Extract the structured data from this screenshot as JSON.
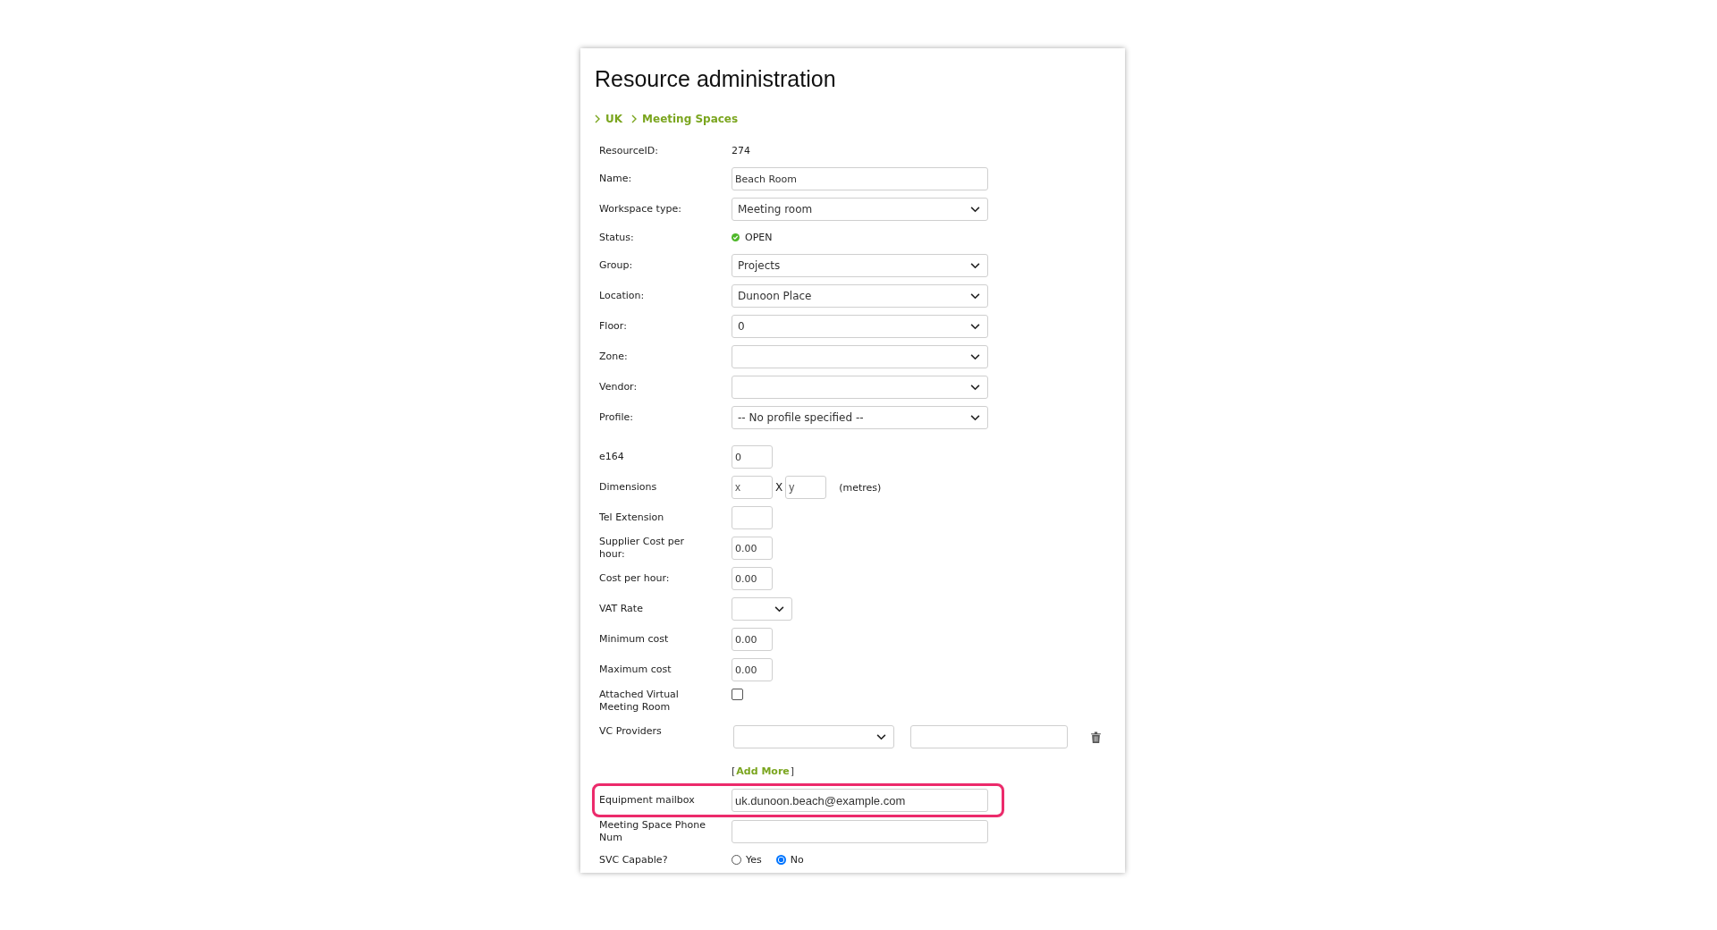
{
  "title": "Resource administration",
  "breadcrumb": [
    "UK",
    "Meeting Spaces"
  ],
  "rows": [
    {
      "kind": "text",
      "label": "ResourceID:",
      "value": "274"
    },
    {
      "kind": "input",
      "label": "Name:",
      "value": "Beach Room"
    },
    {
      "kind": "select",
      "label": "Workspace type:",
      "value": "Meeting room"
    },
    {
      "kind": "status",
      "label": "Status:",
      "value": "OPEN"
    },
    {
      "kind": "select",
      "label": "Group:",
      "value": "Projects"
    },
    {
      "kind": "select",
      "label": "Location:",
      "value": "Dunoon Place"
    },
    {
      "kind": "select",
      "label": "Floor:",
      "value": "0"
    },
    {
      "kind": "select",
      "label": "Zone:"
    },
    {
      "kind": "select",
      "label": "Vendor:"
    },
    {
      "kind": "select",
      "label": "Profile:",
      "value": "-- No profile specified --"
    },
    {
      "kind": "small_input",
      "label": "e164",
      "value": "0"
    },
    {
      "kind": "dimensions",
      "label": "Dimensions",
      "x_placeholder": "x",
      "separator": "X",
      "y_placeholder": "y",
      "unit": "(metres)"
    },
    {
      "kind": "small_input",
      "label": "Tel Extension"
    },
    {
      "kind": "small_input",
      "label": "Supplier Cost per hour:",
      "value": "0.00"
    },
    {
      "kind": "small_input",
      "label": "Cost per hour:",
      "value": "0.00"
    },
    {
      "kind": "small_select",
      "label": "VAT Rate"
    },
    {
      "kind": "small_input",
      "label": "Minimum cost",
      "value": "0.00"
    },
    {
      "kind": "small_input",
      "label": "Maximum cost",
      "value": "0.00"
    },
    {
      "kind": "checkbox",
      "label": "Attached Virtual Meeting Room",
      "checked": false
    },
    {
      "kind": "vc",
      "label": "VC Providers"
    },
    {
      "kind": "add_more",
      "open": "[",
      "link": "Add More",
      "close": "]"
    },
    {
      "kind": "input",
      "label": "Equipment mailbox",
      "value": "uk.dunoon.beach@example.com",
      "highlighted": true
    },
    {
      "kind": "input",
      "label": "Meeting Space Phone Num"
    },
    {
      "kind": "radio",
      "label": "SVC Capable?",
      "options": [
        {
          "label": "Yes",
          "selected": false
        },
        {
          "label": "No",
          "selected": true
        }
      ]
    }
  ]
}
